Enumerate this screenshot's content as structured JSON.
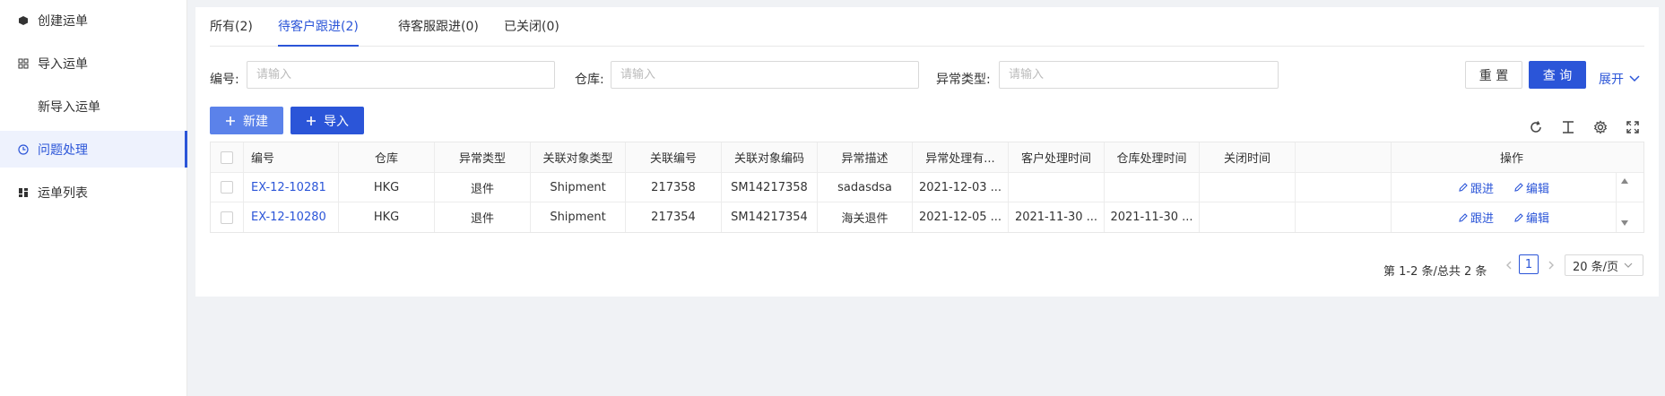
{
  "sidebar": {
    "items": [
      {
        "label": "创建运单"
      },
      {
        "label": "导入运单"
      },
      {
        "label": "新导入运单"
      },
      {
        "label": "问题处理"
      },
      {
        "label": "运单列表"
      }
    ]
  },
  "tabs": [
    {
      "label": "所有(2)"
    },
    {
      "label": "待客户跟进(2)"
    },
    {
      "label": "待客服跟进(0)"
    },
    {
      "label": "已关闭(0)"
    }
  ],
  "filters": {
    "code_label": "编号:",
    "code_placeholder": "请输入",
    "warehouse_label": "仓库:",
    "warehouse_placeholder": "请输入",
    "exception_type_label": "异常类型:",
    "exception_type_placeholder": "请输入",
    "reset_label": "重 置",
    "query_label": "查 询",
    "expand_label": "展开"
  },
  "toolbar": {
    "new_label": "新建",
    "import_label": "导入"
  },
  "table": {
    "headers": [
      "编号",
      "仓库",
      "异常类型",
      "关联对象类型",
      "关联编号",
      "关联对象编码",
      "异常描述",
      "异常处理有...",
      "客户处理时间",
      "仓库处理时间",
      "关闭时间",
      "",
      "操作"
    ],
    "rows": [
      {
        "code": "EX-12-10281",
        "warehouse": "HKG",
        "type": "退件",
        "obj_type": "Shipment",
        "rel_no": "217358",
        "obj_code": "SM14217358",
        "desc": "sadasdsa",
        "deadline": "2021-12-03 ...",
        "cust_time": "",
        "wh_time": "",
        "close_time": "",
        "act_follow": "跟进",
        "act_edit": "编辑"
      },
      {
        "code": "EX-12-10280",
        "warehouse": "HKG",
        "type": "退件",
        "obj_type": "Shipment",
        "rel_no": "217354",
        "obj_code": "SM14217354",
        "desc": "海关退件",
        "deadline": "2021-12-05 ...",
        "cust_time": "2021-11-30 ...",
        "wh_time": "2021-11-30 ...",
        "close_time": "",
        "act_follow": "跟进",
        "act_edit": "编辑"
      }
    ]
  },
  "pagination": {
    "summary": "第 1-2 条/总共 2 条",
    "current": "1",
    "page_size": "20 条/页"
  },
  "colors": {
    "primary": "#2b55d8",
    "primary_light": "#5b82ea"
  }
}
